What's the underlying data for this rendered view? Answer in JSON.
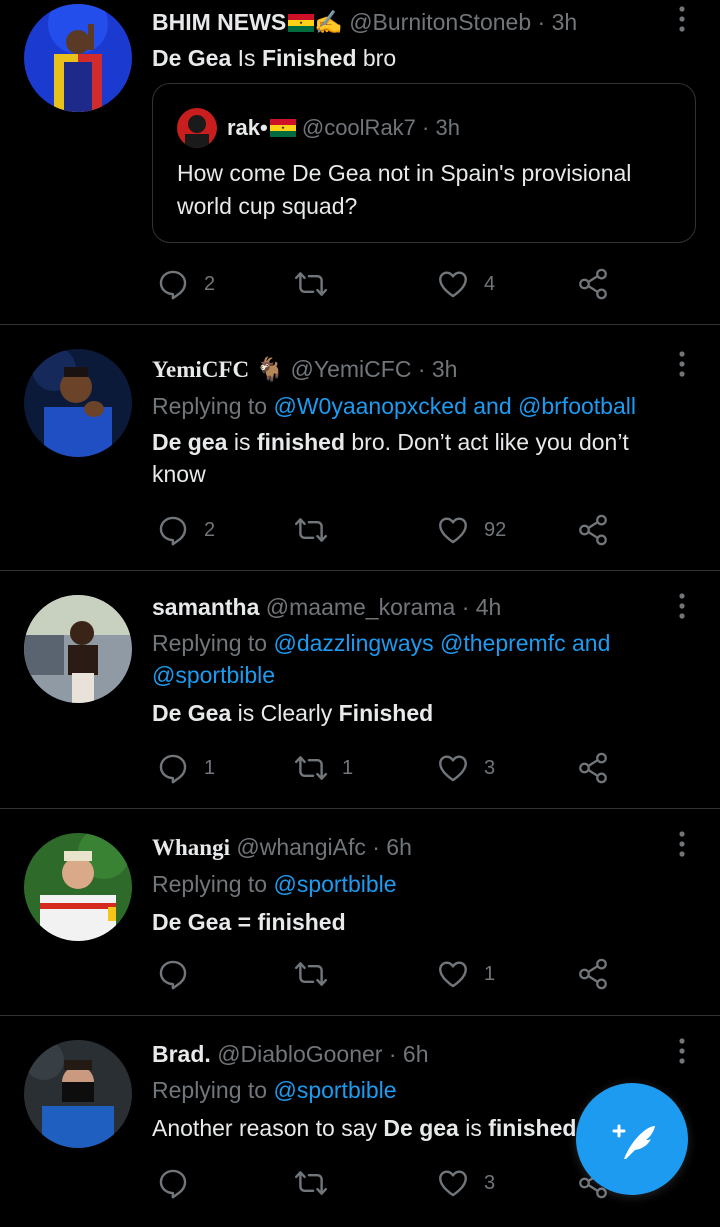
{
  "colors": {
    "background": "#000000",
    "text": "#e7e9ea",
    "muted": "#71767b",
    "link": "#1d9bf0",
    "divider": "#2f3336"
  },
  "tweets": [
    {
      "name": "BHIM NEWS",
      "name_emoji": "✍️",
      "handle": "@BurnitonStoneb",
      "dot": "·",
      "time": "3h",
      "text_parts": [
        "De Gea",
        " Is ",
        "Finished",
        " bro"
      ],
      "quote": {
        "name": "rak•",
        "handle": "@coolRak7",
        "dot": "·",
        "time": "3h",
        "text": "How come De Gea not in Spain's provisional world cup squad?"
      },
      "replies": "2",
      "retweets": "",
      "likes": "4"
    },
    {
      "name": "YemiCFC",
      "name_emoji": "🐐",
      "handle": "@YemiCFC",
      "dot": "·",
      "time": "3h",
      "replying_prefix": "Replying to ",
      "replying_to": "@W0yaanopxcked and @brfootball",
      "text_parts": [
        "De gea",
        " is ",
        "finished",
        " bro. Don’t act like you don’t know"
      ],
      "replies": "2",
      "retweets": "",
      "likes": "92"
    },
    {
      "name": "samantha",
      "handle": "@maame_korama",
      "dot": "·",
      "time": "4h",
      "replying_prefix": "Replying to ",
      "replying_to": "@dazzlingways @thepremfc and @sportbible",
      "text_parts": [
        "De Gea",
        " is Clearly ",
        "Finished",
        ""
      ],
      "replies": "1",
      "retweets": "1",
      "likes": "3"
    },
    {
      "name": "Whangi",
      "handle": "@whangiAfc",
      "dot": "·",
      "time": "6h",
      "replying_prefix": "Replying to ",
      "replying_to": "@sportbible",
      "text_parts": [
        "De Gea = finished",
        "",
        "",
        ""
      ],
      "replies": "",
      "retweets": "",
      "likes": "1"
    },
    {
      "name": "Brad.",
      "handle": "@DiabloGooner",
      "dot": "·",
      "time": "6h",
      "replying_prefix": "Replying to ",
      "replying_to": "@sportbible",
      "text_parts": [
        "",
        "Another reason to say ",
        "De gea",
        " is ",
        "finished"
      ],
      "replies": "",
      "retweets": "",
      "likes": "3"
    }
  ],
  "icons": [
    "reply-icon",
    "retweet-icon",
    "like-icon",
    "share-icon",
    "more-icon",
    "compose-icon"
  ]
}
